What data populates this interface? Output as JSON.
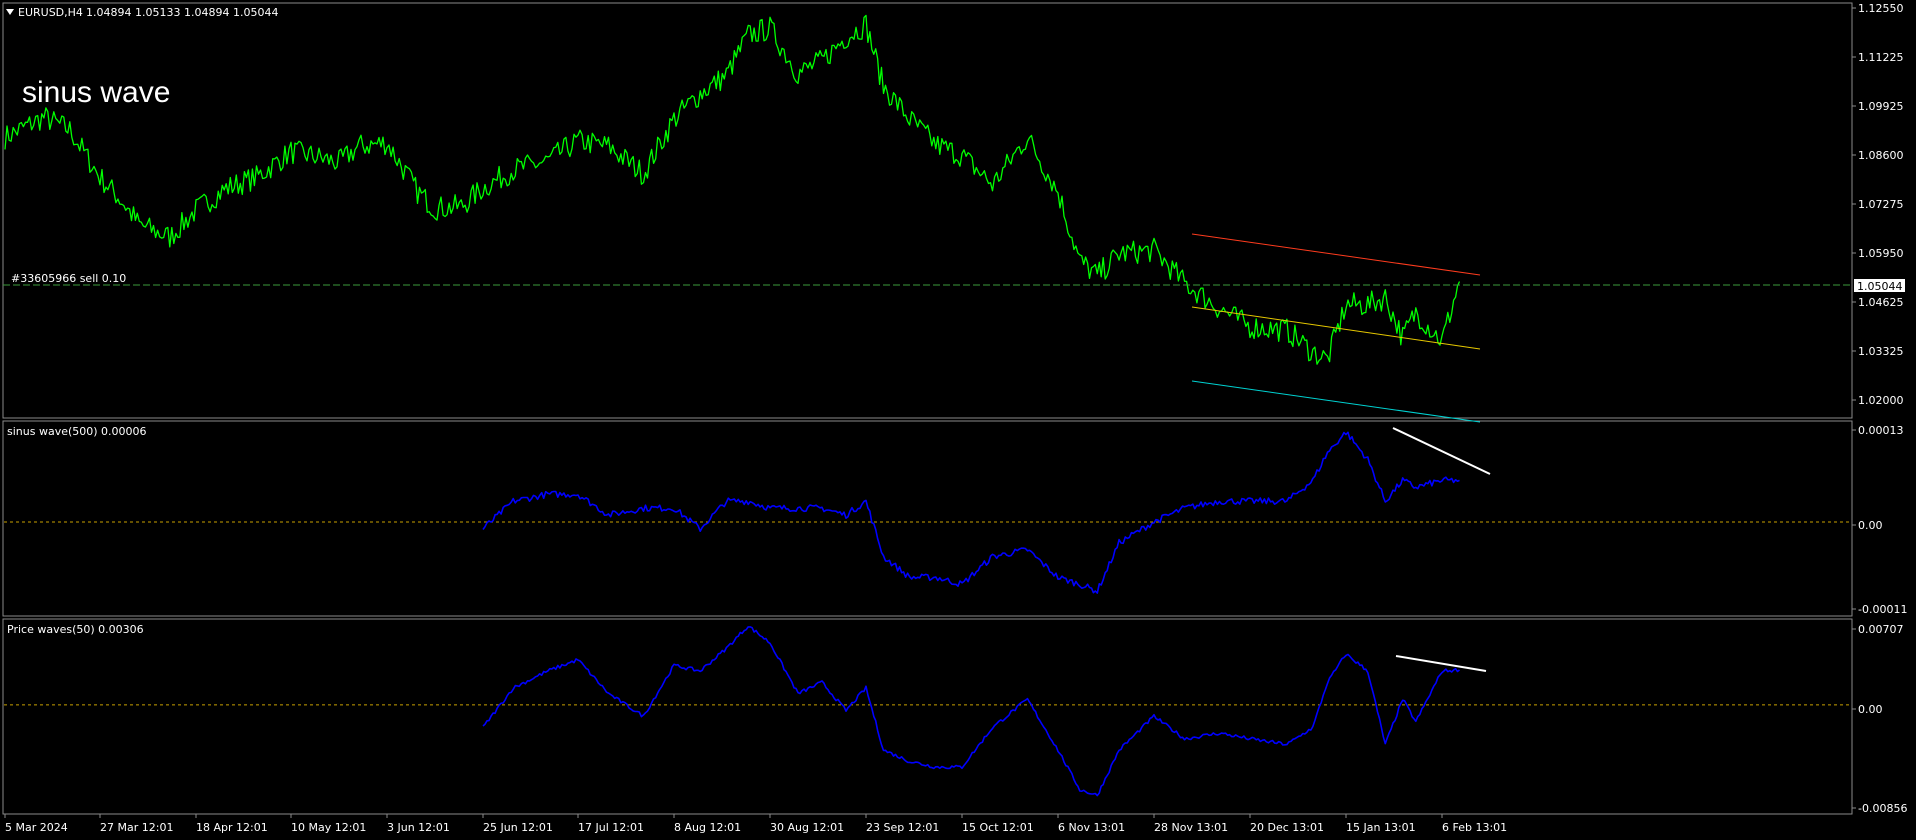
{
  "header": {
    "symbol": "EURUSD,H4",
    "ohlc": "1.04894 1.05133 1.04894 1.05044",
    "study_label": "sinus wave",
    "order_label": "#33605966 sell 0.10",
    "current_price": "1.05044"
  },
  "colors": {
    "background": "#000000",
    "price_line": "#00ff00",
    "indicator_line": "#0000ff",
    "zero_line": "#c8a000",
    "order_line": "#3c9a3c",
    "channel_top": "#ff3c1e",
    "channel_mid": "#e6c800",
    "channel_bottom": "#00d2d2",
    "trend_line": "#ffffff",
    "pane_border": "#8a8a8a"
  },
  "x_axis_labels": [
    "5 Mar 2024",
    "27 Mar 12:01",
    "18 Apr 12:01",
    "10 May 12:01",
    "3 Jun 12:01",
    "25 Jun 12:01",
    "17 Jul 12:01",
    "8 Aug 12:01",
    "30 Aug 12:01",
    "23 Sep 12:01",
    "15 Oct 12:01",
    "6 Nov 13:01",
    "28 Nov 13:01",
    "20 Dec 13:01",
    "15 Jan 13:01",
    "6 Feb 13:01"
  ],
  "chart_data": [
    {
      "type": "line",
      "title": "EURUSD,H4 1.04894 1.05133 1.04894 1.05044",
      "ylim": [
        1.014,
        1.1255
      ],
      "y_ticks": [
        "1.12550",
        "1.11225",
        "1.09925",
        "1.08600",
        "1.07275",
        "1.05950",
        "1.04625",
        "1.03325",
        "1.02000"
      ],
      "x_ticks": [
        "5 Mar 2024",
        "27 Mar 12:01",
        "18 Apr 12:01",
        "10 May 12:01",
        "3 Jun 12:01",
        "25 Jun 12:01",
        "17 Jul 12:01",
        "8 Aug 12:01",
        "30 Aug 12:01",
        "23 Sep 12:01",
        "15 Oct 12:01",
        "6 Nov 13:01",
        "28 Nov 13:01",
        "20 Dec 13:01",
        "15 Jan 13:01",
        "6 Feb 13:01"
      ],
      "x": [
        "5 Mar 2024",
        "14 Mar",
        "20 Mar",
        "27 Mar 12:01",
        "1 Apr",
        "5 Apr",
        "12 Apr",
        "18 Apr 12:01",
        "25 Apr",
        "2 May",
        "10 May 12:01",
        "15 May",
        "22 May",
        "27 May",
        "3 Jun 12:01",
        "10 Jun",
        "14 Jun",
        "20 Jun",
        "25 Jun 12:01",
        "2 Jul",
        "10 Jul",
        "17 Jul 12:01",
        "24 Jul",
        "1 Aug",
        "8 Aug 12:01",
        "14 Aug",
        "20 Aug",
        "25 Aug",
        "30 Aug 12:01",
        "6 Sep",
        "12 Sep",
        "18 Sep",
        "23 Sep 12:01",
        "27 Sep",
        "3 Oct",
        "9 Oct",
        "15 Oct 12:01",
        "22 Oct",
        "30 Oct",
        "6 Nov 13:01",
        "11 Nov",
        "15 Nov",
        "20 Nov",
        "28 Nov 13:01",
        "5 Dec",
        "13 Dec",
        "20 Dec 13:01",
        "30 Dec",
        "6 Jan",
        "10 Jan",
        "15 Jan 13:01",
        "20 Jan",
        "24 Jan",
        "28 Jan",
        "31 Jan",
        "6 Feb 13:01",
        "10 Feb"
      ],
      "values": [
        1.09,
        1.0955,
        1.092,
        1.079,
        1.0725,
        1.066,
        1.0625,
        1.07,
        1.076,
        1.079,
        1.086,
        1.085,
        1.083,
        1.0875,
        1.0885,
        1.075,
        1.0705,
        1.071,
        1.076,
        1.081,
        1.0835,
        1.089,
        1.0875,
        1.08,
        1.095,
        1.102,
        1.107,
        1.118,
        1.12,
        1.1075,
        1.111,
        1.1175,
        1.121,
        1.104,
        1.095,
        1.088,
        1.085,
        1.077,
        1.09,
        1.075,
        1.056,
        1.052,
        1.058,
        1.059,
        1.05,
        1.043,
        1.038,
        1.037,
        1.031,
        1.029,
        1.044,
        1.044,
        1.046,
        1.035,
        1.042,
        1.034,
        1.0504
      ],
      "series": [
        {
          "name": "EURUSD,H4",
          "values": [
            1.09,
            1.0955,
            1.092,
            1.079,
            1.0725,
            1.066,
            1.0625,
            1.07,
            1.076,
            1.079,
            1.086,
            1.085,
            1.083,
            1.0875,
            1.0885,
            1.075,
            1.0705,
            1.071,
            1.076,
            1.081,
            1.0835,
            1.089,
            1.0875,
            1.08,
            1.095,
            1.102,
            1.107,
            1.118,
            1.12,
            1.1075,
            1.111,
            1.1175,
            1.121,
            1.104,
            1.095,
            1.088,
            1.085,
            1.077,
            1.09,
            1.075,
            1.056,
            1.052,
            1.058,
            1.059,
            1.05,
            1.043,
            1.038,
            1.037,
            1.031,
            1.029,
            1.044,
            1.044,
            1.046,
            1.035,
            1.042,
            1.034,
            1.0504
          ]
        }
      ],
      "annotations": [
        "sinus wave",
        "#33605966 sell 0.10",
        "1.05044"
      ],
      "grid": false
    },
    {
      "type": "line",
      "title": "sinus wave(500) 0.00006",
      "ylim": [
        -0.00013,
        0.00014
      ],
      "y_ticks": [
        "0.00013",
        "0.00",
        "-0.00011"
      ],
      "x": [
        "25 Jun",
        "2 Jul",
        "10 Jul",
        "17 Jul 12:01",
        "24 Jul",
        "1 Aug",
        "8 Aug 12:01",
        "14 Aug",
        "20 Aug",
        "25 Aug",
        "30 Aug 12:01",
        "6 Sep",
        "12 Sep",
        "18 Sep",
        "23 Sep 12:01",
        "27 Sep",
        "3 Oct",
        "9 Oct",
        "15 Oct 12:01",
        "22 Oct",
        "30 Oct",
        "6 Nov 13:01",
        "11 Nov",
        "15 Nov",
        "20 Nov",
        "28 Nov 13:01",
        "5 Dec",
        "13 Dec",
        "20 Dec 13:01",
        "30 Dec",
        "6 Jan",
        "10 Jan",
        "15 Jan 13:01",
        "20 Jan",
        "24 Jan",
        "28 Jan",
        "31 Jan",
        "6 Feb 13:01",
        "10 Feb"
      ],
      "values": [
        -1e-05,
        3e-05,
        4e-05,
        4e-05,
        1e-05,
        2e-05,
        2e-05,
        -1e-05,
        3e-05,
        3e-05,
        2e-05,
        2e-05,
        2e-05,
        1e-05,
        3e-05,
        -5e-05,
        -8e-05,
        -8e-05,
        -9e-05,
        -5e-05,
        -4e-05,
        -8e-05,
        -9e-05,
        -0.0001,
        -3e-05,
        0.0,
        2e-05,
        3e-05,
        3e-05,
        3e-05,
        6e-05,
        0.0001,
        0.00013,
        9e-05,
        3e-05,
        6e-05,
        5e-05,
        6e-05,
        6e-05
      ],
      "zero_line": 0.0
    },
    {
      "type": "line",
      "title": "Price waves(50) 0.00306",
      "ylim": [
        -0.0093,
        0.00725
      ],
      "y_ticks": [
        "0.00707",
        "0.00",
        "-0.00856"
      ],
      "x": [
        "25 Jun",
        "2 Jul",
        "10 Jul",
        "17 Jul 12:01",
        "24 Jul",
        "1 Aug",
        "8 Aug 12:01",
        "14 Aug",
        "20 Aug",
        "25 Aug",
        "30 Aug 12:01",
        "6 Sep",
        "12 Sep",
        "18 Sep",
        "23 Sep 12:01",
        "27 Sep",
        "3 Oct",
        "9 Oct",
        "15 Oct 12:01",
        "22 Oct",
        "30 Oct",
        "6 Nov 13:01",
        "11 Nov",
        "15 Nov",
        "20 Nov",
        "28 Nov 13:01",
        "5 Dec",
        "13 Dec",
        "20 Dec 13:01",
        "30 Dec",
        "6 Jan",
        "10 Jan",
        "15 Jan 13:01",
        "20 Jan",
        "24 Jan",
        "28 Jan",
        "31 Jan",
        "6 Feb 13:01",
        "10 Feb"
      ],
      "values": [
        -0.002,
        0.0015,
        0.003,
        0.004,
        0.001,
        -0.001,
        0.0035,
        0.003,
        0.005,
        0.007,
        0.0055,
        0.001,
        0.002,
        -0.0005,
        0.0015,
        -0.004,
        -0.005,
        -0.0055,
        -0.0055,
        -0.002,
        0.0005,
        -0.004,
        -0.0075,
        -0.008,
        -0.004,
        -0.001,
        -0.003,
        -0.0025,
        -0.003,
        -0.0035,
        -0.002,
        0.002,
        0.0045,
        0.003,
        -0.0035,
        0.0005,
        -0.0015,
        0.003,
        0.0031
      ],
      "zero_line": 0.0
    }
  ]
}
